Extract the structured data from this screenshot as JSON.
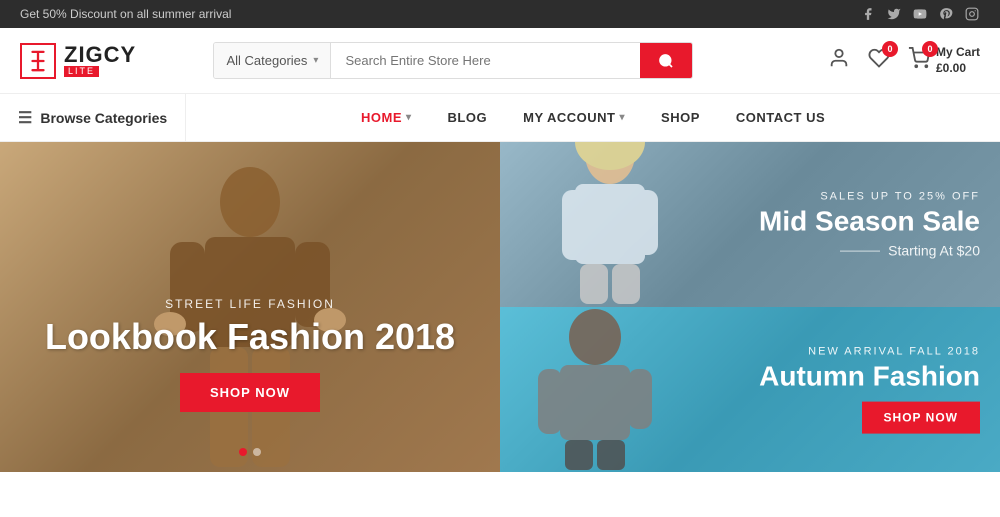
{
  "topbar": {
    "promo": "Get 50% Discount on all summer arrival",
    "social_icons": [
      "facebook",
      "twitter",
      "youtube",
      "pinterest",
      "instagram"
    ]
  },
  "header": {
    "logo_text": "ZIGCY",
    "logo_sub": "LITE",
    "search": {
      "category_label": "All Categories",
      "placeholder": "Search Entire Store Here"
    },
    "wishlist_badge": "0",
    "cart": {
      "label": "My Cart",
      "amount": "£0.00",
      "badge": "0"
    }
  },
  "navbar": {
    "browse_label": "Browse Categories",
    "items": [
      {
        "label": "HOME",
        "has_dropdown": true,
        "active": true
      },
      {
        "label": "BLOG",
        "has_dropdown": false
      },
      {
        "label": "MY ACCOUNT",
        "has_dropdown": true
      },
      {
        "label": "SHOP",
        "has_dropdown": false
      },
      {
        "label": "CONTACT US",
        "has_dropdown": false
      }
    ]
  },
  "hero_left": {
    "subtitle": "STREET LIFE FASHION",
    "title": "Lookbook Fashion 2018",
    "button": "SHOP NOW",
    "bg_color": "#b8906a"
  },
  "hero_right_top": {
    "promo_tag": "SALES UP TO 25% OFF",
    "title": "Mid Season Sale",
    "price_label": "Starting At $20",
    "bg_color": "#7fa8bc"
  },
  "hero_right_bottom": {
    "promo_tag": "NEW ARRIVAL FALL 2018",
    "title": "Autumn Fashion",
    "button": "SHOP NOW",
    "bg_color": "#4ab8d0"
  },
  "dots": [
    "active",
    "inactive"
  ]
}
